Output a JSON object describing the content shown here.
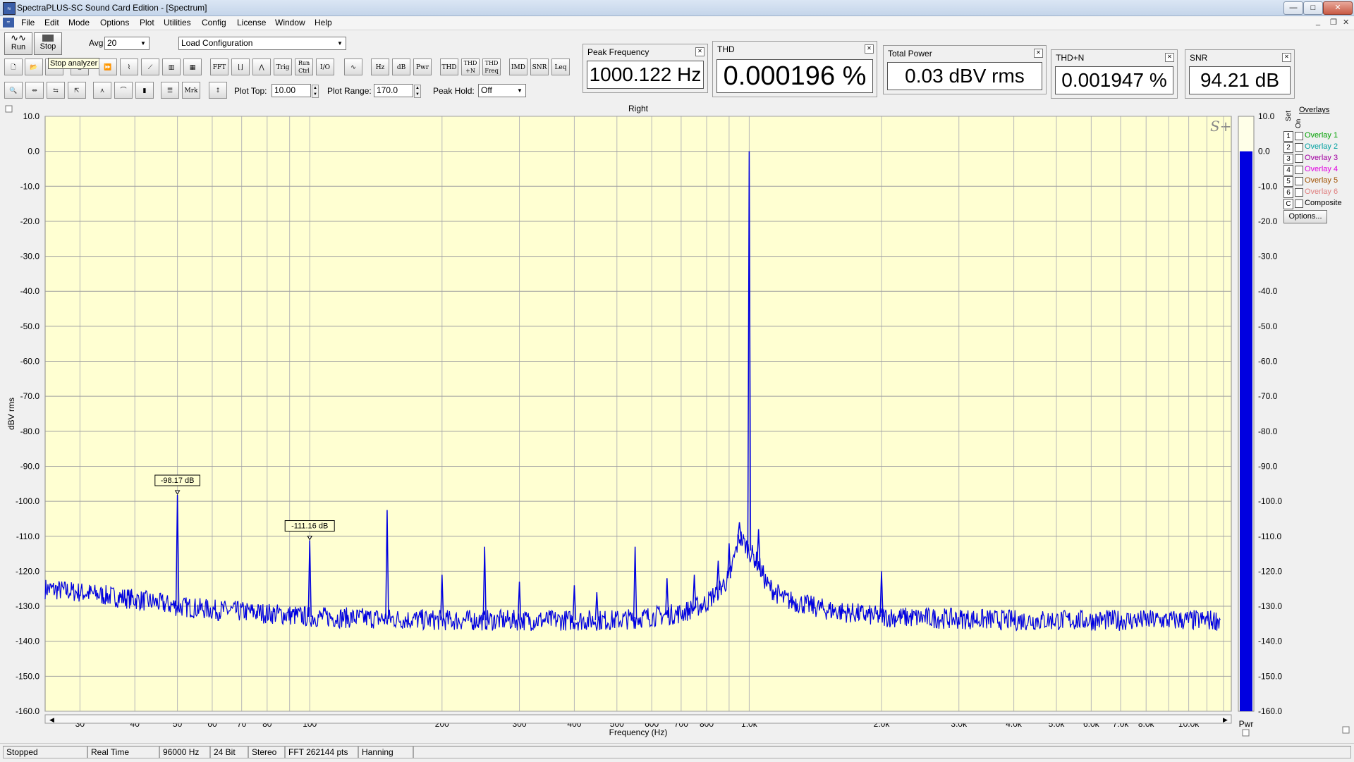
{
  "window": {
    "title": "SpectraPLUS-SC Sound Card Edition - [Spectrum]",
    "app_icon": "spectrum-app-icon",
    "controls": [
      "minimize-icon",
      "maximize-icon",
      "close-icon"
    ]
  },
  "menu": [
    "File",
    "Edit",
    "Mode",
    "Options",
    "Plot",
    "Utilities",
    "Config",
    "License",
    "Window",
    "Help"
  ],
  "toolbar": {
    "run_label": "Run",
    "stop_label": "Stop",
    "tooltip": "Stop analyzer",
    "avg_label": "Avg",
    "avg_value": "20",
    "load_config": "Load Configuration",
    "row2_buttons": [
      "FFT",
      "Trig",
      "Run Ctrl",
      "I/O",
      "Hz",
      "dB",
      "Pwr",
      "THD",
      "THD +N",
      "THD Freq",
      "IMD",
      "SNR",
      "Leq"
    ],
    "row3_buttons": [
      "Mrk"
    ],
    "plot_top_label": "Plot Top:",
    "plot_top_value": "10.00",
    "plot_range_label": "Plot Range:",
    "plot_range_value": "170.0",
    "peak_hold_label": "Peak Hold:",
    "peak_hold_value": "Off"
  },
  "meters": [
    {
      "title": "Peak Frequency",
      "value": "1000.122 Hz"
    },
    {
      "title": "THD",
      "value": "0.000196  %"
    },
    {
      "title": "Total Power",
      "value": "0.03 dBV rms"
    },
    {
      "title": "THD+N",
      "value": "0.001947 %"
    },
    {
      "title": "SNR",
      "value": "94.21 dB"
    }
  ],
  "plot": {
    "channel": "Right",
    "logo": "S+",
    "bg_color": "#ffffd2",
    "trace_color": "#0000e0",
    "bar_color": "#0000e0"
  },
  "overlays": {
    "title": "Overlays",
    "set_label": "Set",
    "on_label": "On",
    "items": [
      {
        "num": "1",
        "name": "Overlay 1",
        "color": "#00a000",
        "checked": false
      },
      {
        "num": "2",
        "name": "Overlay 2",
        "color": "#00a0a0",
        "checked": false
      },
      {
        "num": "3",
        "name": "Overlay 3",
        "color": "#a000a0",
        "checked": false
      },
      {
        "num": "4",
        "name": "Overlay 4",
        "color": "#e000e0",
        "checked": false
      },
      {
        "num": "5",
        "name": "Overlay 5",
        "color": "#a05000",
        "checked": false
      },
      {
        "num": "6",
        "name": "Overlay 6",
        "color": "#e08080",
        "checked": false
      },
      {
        "num": "C",
        "name": "Composite",
        "color": "#000000",
        "checked": false
      }
    ],
    "options_label": "Options..."
  },
  "chart_data": {
    "type": "line",
    "title": "Right",
    "xlabel": "Frequency (Hz)",
    "ylabel": "dBV rms",
    "xscale": "log",
    "xlim": [
      25,
      12500
    ],
    "ylim": [
      -160,
      10
    ],
    "grid": true,
    "x_ticks": [
      30,
      40,
      50,
      60,
      70,
      80,
      100,
      200,
      300,
      400,
      500,
      600,
      700,
      800,
      1000,
      2000,
      3000,
      4000,
      5000,
      6000,
      7000,
      8000,
      10000
    ],
    "x_tick_labels": [
      "30",
      "40",
      "50",
      "60",
      "70",
      "80",
      "100",
      "200",
      "300",
      "400",
      "500",
      "600",
      "700",
      "800",
      "1.0k",
      "2.0k",
      "3.0k",
      "4.0k",
      "5.0k",
      "6.0k",
      "7.0k",
      "8.0k",
      "10.0k"
    ],
    "y_ticks": [
      10,
      0,
      -10,
      -20,
      -30,
      -40,
      -50,
      -60,
      -70,
      -80,
      -90,
      -100,
      -110,
      -120,
      -130,
      -140,
      -150,
      -160
    ],
    "y_tick_labels": [
      "10.0",
      "0.0",
      "-10.0",
      "-20.0",
      "-30.0",
      "-40.0",
      "-50.0",
      "-60.0",
      "-70.0",
      "-80.0",
      "-90.0",
      "-100.0",
      "-110.0",
      "-120.0",
      "-130.0",
      "-140.0",
      "-150.0",
      "-160.0"
    ],
    "noise_floor": [
      [
        25,
        -125
      ],
      [
        30,
        -126
      ],
      [
        40,
        -128
      ],
      [
        50,
        -130
      ],
      [
        60,
        -131
      ],
      [
        80,
        -132
      ],
      [
        100,
        -133
      ],
      [
        200,
        -134
      ],
      [
        500,
        -134
      ],
      [
        700,
        -132
      ],
      [
        800,
        -129
      ],
      [
        900,
        -122
      ],
      [
        950,
        -110
      ],
      [
        1050,
        -118
      ],
      [
        1100,
        -124
      ],
      [
        1200,
        -128
      ],
      [
        1500,
        -131
      ],
      [
        2000,
        -133
      ],
      [
        4000,
        -134
      ],
      [
        12000,
        -134
      ]
    ],
    "peaks": [
      {
        "x": 1000,
        "y": 0
      },
      {
        "x": 50,
        "y": -98.17
      },
      {
        "x": 100,
        "y": -111.16
      },
      {
        "x": 150,
        "y": -102.5
      },
      {
        "x": 200,
        "y": -121
      },
      {
        "x": 250,
        "y": -113
      },
      {
        "x": 300,
        "y": -123
      },
      {
        "x": 400,
        "y": -124
      },
      {
        "x": 450,
        "y": -126
      },
      {
        "x": 550,
        "y": -113
      },
      {
        "x": 650,
        "y": -122
      },
      {
        "x": 750,
        "y": -121
      },
      {
        "x": 850,
        "y": -117
      },
      {
        "x": 900,
        "y": -112
      },
      {
        "x": 950,
        "y": -106
      },
      {
        "x": 1050,
        "y": -108
      },
      {
        "x": 2000,
        "y": -120
      }
    ],
    "markers": [
      {
        "x": 50,
        "y": -98.17,
        "label": "-98.17 dB"
      },
      {
        "x": 100,
        "y": -111.16,
        "label": "-111.16 dB"
      }
    ],
    "power_bar": {
      "label": "Pwr",
      "value": 0
    }
  },
  "status": [
    "Stopped",
    "Real Time",
    "96000 Hz",
    "24 Bit",
    "Stereo",
    "FFT 262144 pts",
    "Hanning"
  ]
}
